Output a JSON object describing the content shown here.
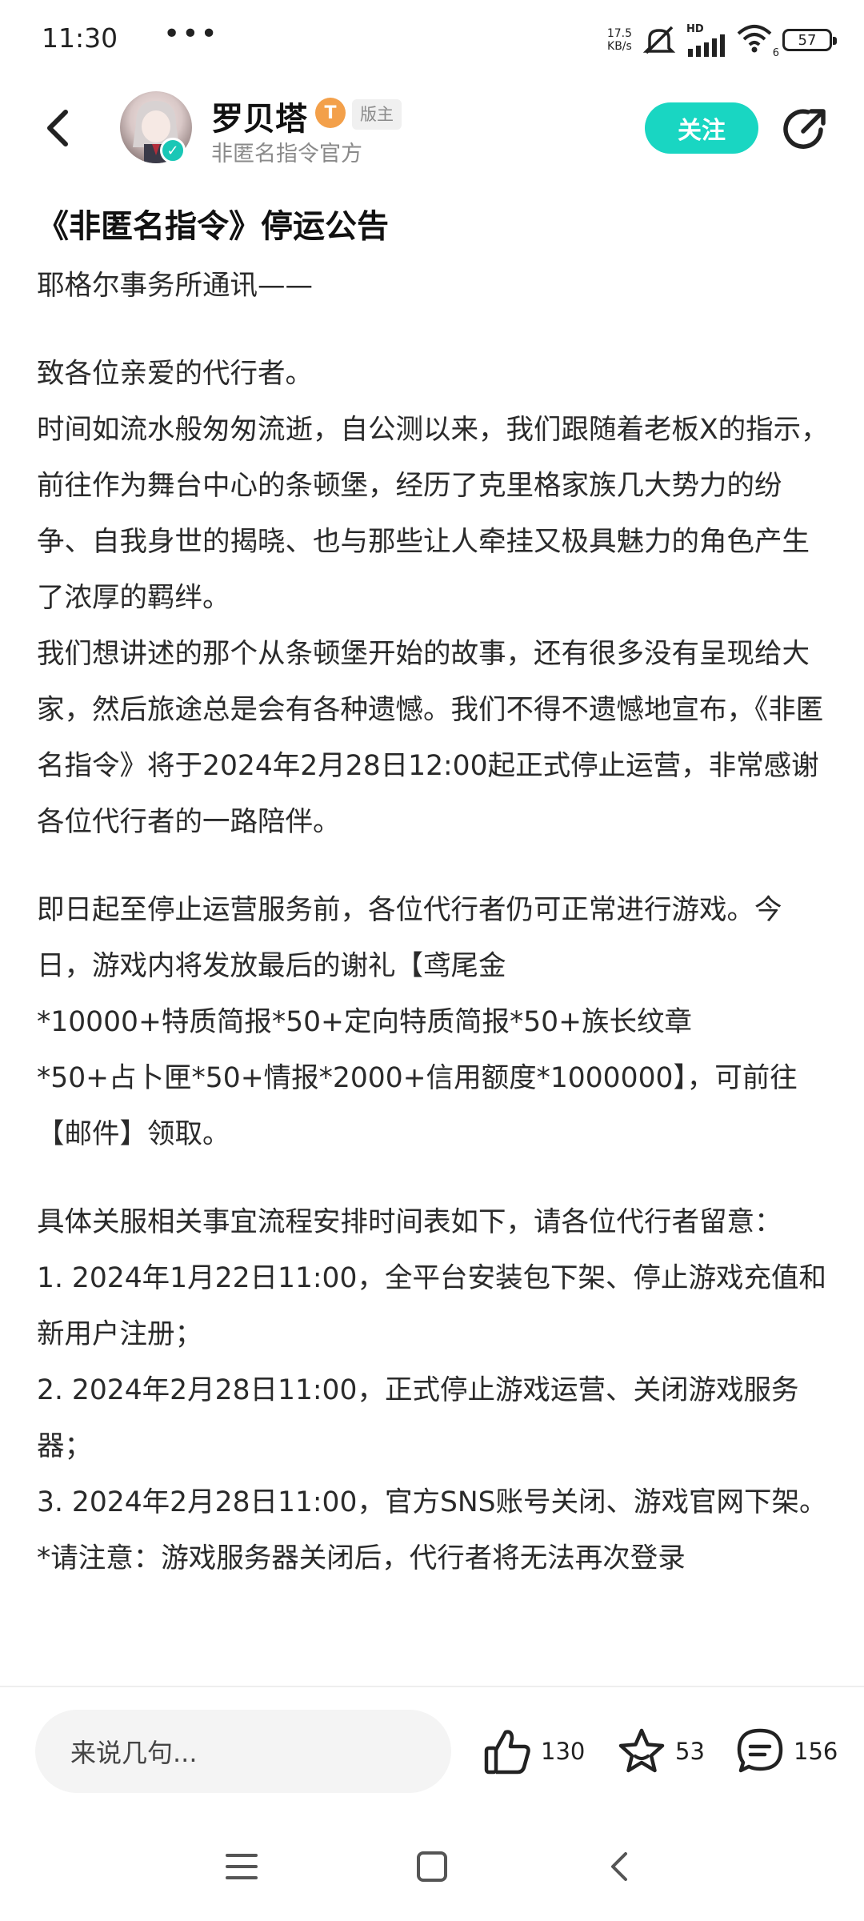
{
  "status_bar": {
    "time": "11:30",
    "dots": "•••",
    "net_speed_value": "17.5",
    "net_speed_unit": "KB/s",
    "network_label": "HD",
    "wifi_sub": "6",
    "battery_level": "57"
  },
  "header": {
    "author_name": "罗贝塔",
    "level_badge": "T",
    "role_tag": "版主",
    "subtitle": "非匿名指令官方",
    "follow_label": "关注",
    "accent_color": "#19d6c2"
  },
  "article": {
    "title": "《非匿名指令》停运公告",
    "lines": [
      "耶格尔事务所通讯——",
      "致各位亲爱的代行者。",
      "时间如流水般匆匆流逝，自公测以来，我们跟随着老板X的指示，前往作为舞台中心的条顿堡，经历了克里格家族几大势力的纷争、自我身世的揭晓、也与那些让人牵挂又极具魅力的角色产生了浓厚的羁绊。",
      "我们想讲述的那个从条顿堡开始的故事，还有很多没有呈现给大家，然后旅途总是会有各种遗憾。我们不得不遗憾地宣布，《非匿名指令》将于2024年2月28日12:00起正式停止运营，非常感谢各位代行者的一路陪伴。",
      "即日起至停止运营服务前，各位代行者仍可正常进行游戏。今日，游戏内将发放最后的谢礼【鸢尾金",
      "*10000+特质简报*50+定向特质简报*50+族长纹章",
      "*50+占卜匣*50+情报*2000+信用额度*1000000】，可前往【邮件】领取。",
      "具体关服相关事宜流程安排时间表如下，请各位代行者留意：",
      "1. 2024年1月22日11:00，全平台安装包下架、停止游戏充值和新用户注册；",
      "2. 2024年2月28日11:00，正式停止游戏运营、关闭游戏服务器；",
      "3. 2024年2月28日11:00，官方SNS账号关闭、游戏官网下架。",
      "*请注意：游戏服务器关闭后，代行者将无法再次登录"
    ]
  },
  "bottom_bar": {
    "comment_placeholder": "来说几句...",
    "likes": "130",
    "favorites": "53",
    "comments": "156"
  }
}
